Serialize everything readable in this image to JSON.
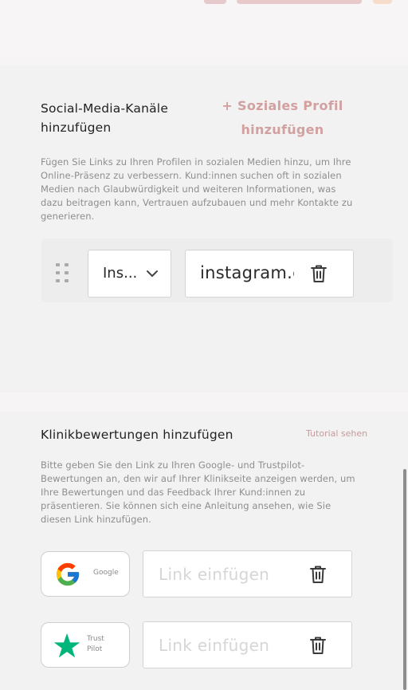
{
  "social": {
    "title_line1": "Social-Media-Kanäle",
    "title_line2": "hinzufügen",
    "add_button_line1": "+ Soziales Profil",
    "add_button_line2": "hinzufügen",
    "description": [
      "Fügen Sie Links zu Ihren Profilen in sozialen Medien hinzu, um Ihre",
      "Online-Präsenz zu verbessern. Kund:innen suchen oft in sozialen",
      "Medien nach Glaubwürdigkeit und weiteren Informationen, was",
      "dazu beitragen kann, Vertrauen aufzubauen und mehr Kontakte zu",
      "generieren."
    ],
    "rows": [
      {
        "platform": "Ins...",
        "url": "instagram.com"
      }
    ]
  },
  "reviews": {
    "title": "Klinikbewertungen hinzufügen",
    "tutorial_link": "Tutorial sehen",
    "description": [
      "Bitte geben Sie den Link zu Ihren Google- und Trustpilot-",
      "Bewertungen an, den wir auf Ihrer Klinikseite anzeigen werden, um",
      "Ihre Bewertungen und das Feedback Ihrer Kund:innen zu",
      "präsentieren. Sie können sich eine Anleitung ansehen, wie Sie",
      "diesen Link hinzufügen."
    ],
    "google": {
      "name": "Google",
      "placeholder": "Link einfügen",
      "icon": "google-icon"
    },
    "trustpilot": {
      "name_line1": "Trust",
      "name_line2": "Pilot",
      "placeholder": "Link einfügen",
      "icon": "trustpilot-star-icon"
    }
  },
  "colors": {
    "accent": "#d3a0a0",
    "tutorial": "#c79a9a",
    "trustpilot_green": "#00b67a"
  }
}
